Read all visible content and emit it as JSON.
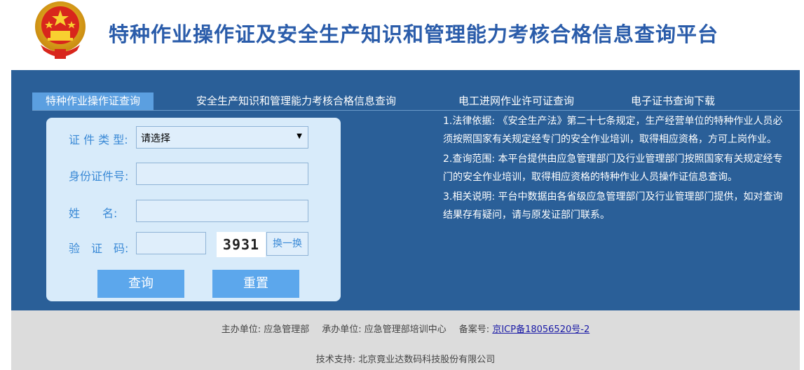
{
  "header": {
    "title": "特种作业操作证及安全生产知识和管理能力考核合格信息查询平台"
  },
  "tabs": [
    {
      "label": "特种作业操作证查询",
      "active": true
    },
    {
      "label": "安全生产知识和管理能力考核合格信息查询",
      "active": false
    },
    {
      "label": "电工进网作业许可证查询",
      "active": false
    },
    {
      "label": "电子证书查询下载",
      "active": false
    }
  ],
  "form": {
    "cert_type_label": "证 件 类 型:",
    "cert_type_value": "请选择",
    "id_label": "身份证件号:",
    "id_value": "",
    "name_label": "姓　　名:",
    "name_value": "",
    "captcha_label": "验　证　码:",
    "captcha_value": "",
    "captcha_image_text": "3931",
    "swap_label": "换一换",
    "query_label": "查询",
    "reset_label": "重置"
  },
  "info": [
    "1.法律依据: 《安全生产法》第二十七条规定，生产经营单位的特种作业人员必须按照国家有关规定经专门的安全作业培训，取得相应资格，方可上岗作业。",
    "2.查询范围: 本平台提供由应急管理部门及行业管理部门按照国家有关规定经专门的安全作业培训，取得相应资格的特种作业人员操作证信息查询。",
    "3.相关说明: 平台中数据由各省级应急管理部门及行业管理部门提供，如对查询结果存有疑问，请与原发证部门联系。"
  ],
  "footer": {
    "host": "主办单位: 应急管理部",
    "organizer": "承办单位: 应急管理部培训中心",
    "record_label": "备案号:",
    "record_link": "京ICP备18056520号-2",
    "support": "技术支持: 北京竟业达数码科技股份有限公司"
  },
  "colors": {
    "main_bg": "#2a5f98",
    "tab_active": "#5b9fe0",
    "form_bg": "#d8ebfa",
    "button": "#5ca7ec",
    "title": "#2a5caa",
    "footer_bg": "#dcdcdc"
  },
  "icons": {
    "emblem": "national-emblem-icon",
    "dropdown": "caret-down-icon"
  }
}
